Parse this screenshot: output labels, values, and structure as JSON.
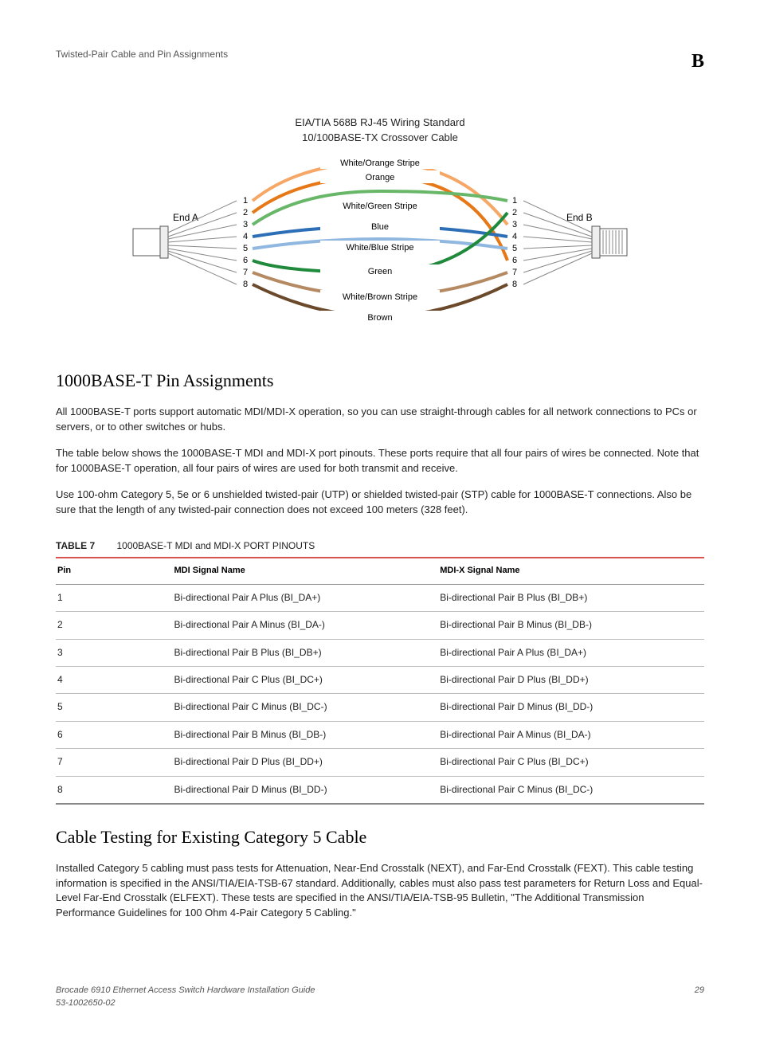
{
  "header": {
    "left": "Twisted-Pair Cable and Pin Assignments",
    "right": "B"
  },
  "diagram": {
    "title_line1": "EIA/TIA 568B RJ-45 Wiring Standard",
    "title_line2": "10/100BASE-TX Crossover Cable",
    "end_a": "End A",
    "end_b": "End B",
    "pins": [
      "1",
      "2",
      "3",
      "4",
      "5",
      "6",
      "7",
      "8"
    ],
    "wires": [
      "White/Orange Stripe",
      "Orange",
      "White/Green Stripe",
      "Blue",
      "White/Blue Stripe",
      "Green",
      "White/Brown Stripe",
      "Brown"
    ]
  },
  "section1": {
    "heading": "1000BASE-T Pin Assignments",
    "p1": "All 1000BASE-T ports support automatic MDI/MDI-X operation, so you can use straight-through cables for all network connections to PCs or servers, or to other switches or hubs.",
    "p2": "The table below shows the 1000BASE-T MDI and MDI-X port pinouts. These ports require that all four pairs of wires be connected. Note that for 1000BASE-T operation, all four pairs of wires are used for both transmit and receive.",
    "p3": "Use 100-ohm Category 5, 5e or 6 unshielded twisted-pair (UTP) or shielded twisted-pair (STP) cable for 1000BASE-T connections. Also be sure that the length of any twisted-pair connection does not exceed 100 meters (328 feet)."
  },
  "table": {
    "label": "TABLE 7",
    "title": "1000BASE-T MDI and MDI-X PORT PINOUTS",
    "headers": [
      "Pin",
      "MDI Signal Name",
      "MDI-X Signal Name"
    ],
    "rows": [
      [
        "1",
        "Bi-directional Pair A Plus (BI_DA+)",
        "Bi-directional Pair B Plus (BI_DB+)"
      ],
      [
        "2",
        "Bi-directional Pair A Minus (BI_DA-)",
        "Bi-directional Pair B Minus (BI_DB-)"
      ],
      [
        "3",
        "Bi-directional Pair B Plus (BI_DB+)",
        "Bi-directional Pair A Plus (BI_DA+)"
      ],
      [
        "4",
        "Bi-directional Pair C Plus (BI_DC+)",
        "Bi-directional Pair D Plus (BI_DD+)"
      ],
      [
        "5",
        "Bi-directional Pair C Minus (BI_DC-)",
        "Bi-directional Pair D Minus (BI_DD-)"
      ],
      [
        "6",
        "Bi-directional Pair B Minus (BI_DB-)",
        "Bi-directional Pair A Minus (BI_DA-)"
      ],
      [
        "7",
        "Bi-directional Pair D Plus (BI_DD+)",
        "Bi-directional Pair C Plus (BI_DC+)"
      ],
      [
        "8",
        "Bi-directional Pair D Minus (BI_DD-)",
        "Bi-directional Pair C Minus (BI_DC-)"
      ]
    ]
  },
  "section2": {
    "heading": "Cable Testing for Existing Category 5 Cable",
    "p1": "Installed Category 5 cabling must pass tests for Attenuation, Near-End Crosstalk (NEXT), and Far-End Crosstalk (FEXT). This cable testing information is specified in the ANSI/TIA/EIA-TSB-67 standard. Additionally, cables must also pass test parameters for Return Loss and Equal-Level Far-End Crosstalk (ELFEXT). These tests are specified in the ANSI/TIA/EIA-TSB-95 Bulletin, \"The Additional Transmission Performance Guidelines for 100 Ohm 4-Pair Category 5 Cabling.\""
  },
  "footer": {
    "left_line1": "Brocade 6910 Ethernet Access Switch Hardware Installation Guide",
    "left_line2": "53-1002650-02",
    "right": "29"
  }
}
